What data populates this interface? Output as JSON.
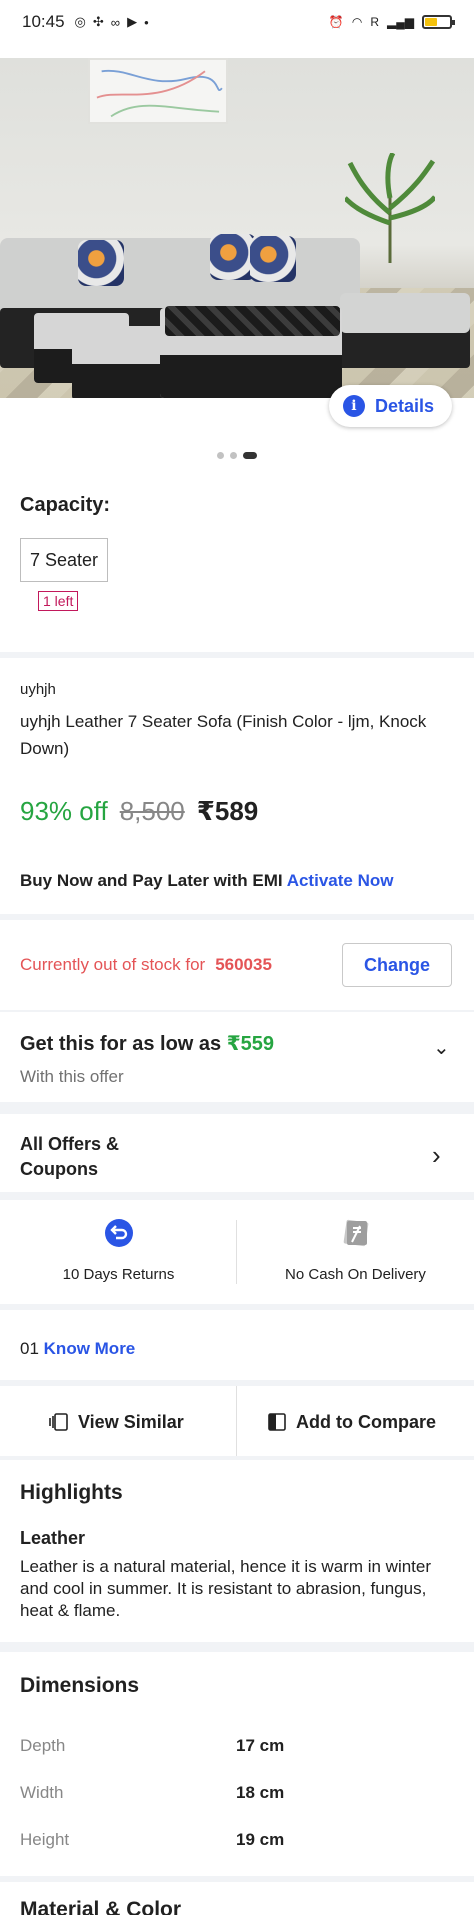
{
  "status_bar": {
    "time": "10:45",
    "network_label": "R"
  },
  "details_button": "Details",
  "capacity": {
    "title": "Capacity:",
    "option": "7 Seater",
    "stock_badge": "1 left"
  },
  "product": {
    "brand": "uyhjh",
    "title": "uyhjh Leather 7 Seater  Sofa (Finish Color - ljm, Knock Down)",
    "discount": "93% off",
    "mrp": "8,500",
    "price": "₹589"
  },
  "emi": {
    "text": "Buy Now and Pay Later with EMI",
    "link": "Activate Now"
  },
  "stock": {
    "text": "Currently out of stock for",
    "pincode": "560035",
    "change_label": "Change"
  },
  "offer": {
    "title": "Get this for as low as",
    "price": "₹559",
    "subtitle": "With this offer"
  },
  "all_offers": "All Offers & Coupons",
  "features": [
    {
      "label": "10 Days Returns",
      "icon": "return-icon"
    },
    {
      "label": "No Cash On Delivery",
      "icon": "no-cash-icon"
    }
  ],
  "know_more": {
    "prefix": "01",
    "link": "Know More"
  },
  "actions": {
    "view_similar": "View Similar",
    "compare": "Add to Compare"
  },
  "highlights": {
    "title": "Highlights",
    "subtitle": "Leather",
    "text": "Leather is a natural material, hence it is warm in winter and cool in summer. It is resistant to abrasion, fungus, heat & flame."
  },
  "dimensions": {
    "title": "Dimensions",
    "rows": [
      {
        "label": "Depth",
        "value": "17 cm"
      },
      {
        "label": "Width",
        "value": "18 cm"
      },
      {
        "label": "Height",
        "value": "19 cm"
      }
    ]
  },
  "material": {
    "title": "Material & Color"
  },
  "colors": {
    "brand_blue": "#2a55e5",
    "green": "#26a541",
    "red": "#e45456",
    "badge_pink": "#c2185b"
  }
}
